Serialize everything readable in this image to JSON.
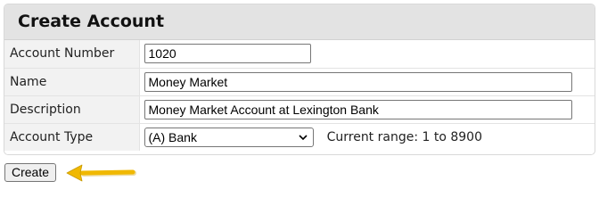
{
  "panel": {
    "title": "Create Account"
  },
  "form": {
    "account_number": {
      "label": "Account Number",
      "value": "1020"
    },
    "name": {
      "label": "Name",
      "value": "Money Market"
    },
    "description": {
      "label": "Description",
      "value": "Money Market Account at Lexington Bank"
    },
    "account_type": {
      "label": "Account Type",
      "selected": "(A) Bank",
      "range_text": "Current range: 1 to 8900"
    }
  },
  "actions": {
    "create_label": "Create"
  },
  "annotation": {
    "arrow_icon": "left-arrow-icon",
    "arrow_color": "#f0b800"
  }
}
